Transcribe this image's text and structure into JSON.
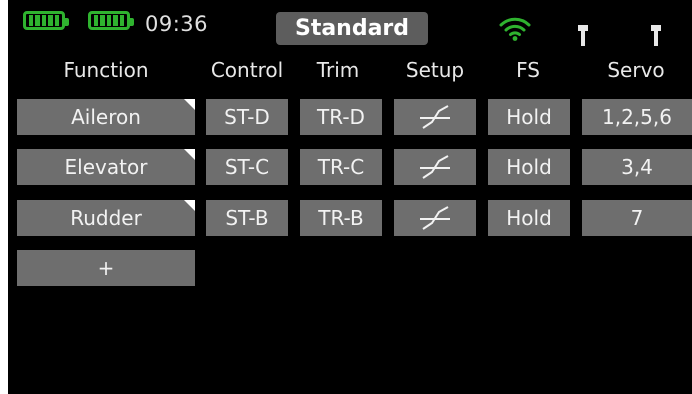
{
  "status": {
    "time": "09:36",
    "mode": "Standard",
    "battery_icons": [
      "battery-icon",
      "battery-icon"
    ],
    "accent_color": "#2fb32f"
  },
  "columns": [
    "Function",
    "Control",
    "Trim",
    "Setup",
    "FS",
    "Servo"
  ],
  "rows": [
    {
      "function": "Aileron",
      "control": "ST-D",
      "trim": "TR-D",
      "setup": "curve-icon",
      "fs": "Hold",
      "servo": "1,2,5,6"
    },
    {
      "function": "Elevator",
      "control": "ST-C",
      "trim": "TR-C",
      "setup": "curve-icon",
      "fs": "Hold",
      "servo": "3,4"
    },
    {
      "function": "Rudder",
      "control": "ST-B",
      "trim": "TR-B",
      "setup": "curve-icon",
      "fs": "Hold",
      "servo": "7"
    }
  ],
  "add_button": "+"
}
